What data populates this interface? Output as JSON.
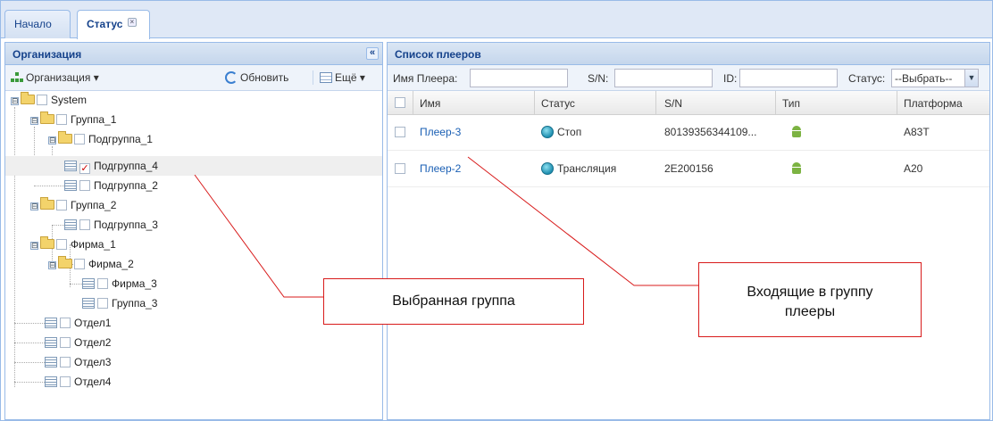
{
  "tabs": [
    {
      "label": "Начало"
    },
    {
      "label": "Статус",
      "close": "×"
    }
  ],
  "left_panel": {
    "title": "Организация",
    "collapse": "«",
    "toolbar": {
      "org_label": "Организация ▾",
      "refresh_label": "Обновить",
      "more_label": "Ещё ▾"
    },
    "tree": [
      {
        "label": "System"
      },
      {
        "label": "Группа_1"
      },
      {
        "label": "Подгруппа_1"
      },
      {
        "label": "Подгруппа_4",
        "checked": true
      },
      {
        "label": "Подгруппа_2"
      },
      {
        "label": "Группа_2"
      },
      {
        "label": "Подгруппа_3"
      },
      {
        "label": "Фирма_1"
      },
      {
        "label": "Фирма_2"
      },
      {
        "label": "Фирма_3"
      },
      {
        "label": "Группа_3"
      },
      {
        "label": "Отдел1"
      },
      {
        "label": "Отдел2"
      },
      {
        "label": "Отдел3"
      },
      {
        "label": "Отдел4"
      }
    ],
    "expander": "⊟",
    "checkmark": "✓"
  },
  "right_panel": {
    "title": "Список плееров",
    "filters": {
      "name_label": "Имя Плеера:",
      "sn_label": "S/N:",
      "id_label": "ID:",
      "status_label": "Статус:",
      "status_value": "--Выбрать--",
      "arrow": "▼"
    },
    "columns": [
      "Имя",
      "Статус",
      "S/N",
      "Тип",
      "Платформа"
    ],
    "rows": [
      {
        "name": "Плеер-3",
        "status": "Стоп",
        "sn": "80139356344109...",
        "type_icon": "android-icon",
        "platform": "A83T"
      },
      {
        "name": "Плеер-2",
        "status": "Трансляция",
        "sn": "2E200156",
        "type_icon": "android-icon",
        "platform": "A20"
      }
    ]
  },
  "callouts": {
    "selected_group": "Выбранная группа",
    "players_in_group": "Входящие в группу плееры"
  },
  "colors": {
    "header_text": "#15428b",
    "border": "#99bbe8",
    "callout_border": "#d81b1b",
    "link": "#1a5fb4"
  }
}
